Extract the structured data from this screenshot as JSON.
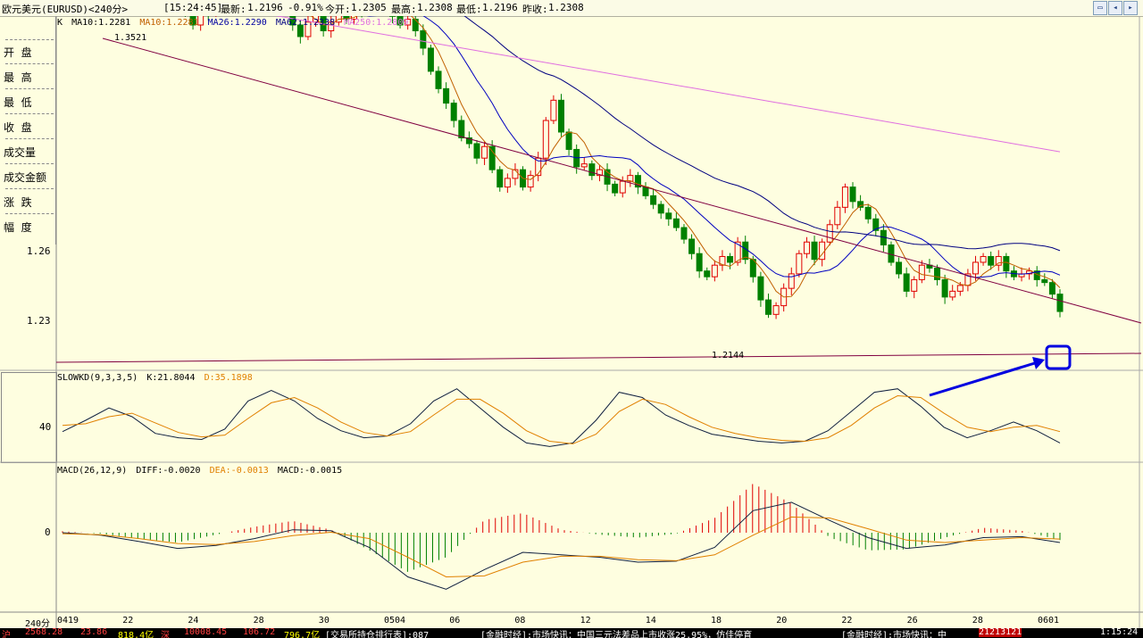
{
  "header": {
    "instrument": "欧元美元(EURUSD)<240分>",
    "time": "[15:24:45]",
    "quote_latest_label": "最新:",
    "quote_latest": "1.2196",
    "quote_change": "-0.91%",
    "quote_open_label": "今开:",
    "quote_open": "1.2305",
    "quote_high_label": "最高:",
    "quote_high": "1.2308",
    "quote_low_label": "最低:",
    "quote_low": "1.2196",
    "quote_prev_label": "昨收:",
    "quote_prev": "1.2308",
    "btn_icons": [
      "window-icon",
      "chevron-left-icon",
      "chevron-right-icon"
    ]
  },
  "left_panel": {
    "items": [
      "开  盘",
      "最  高",
      "最  低",
      "收  盘",
      "成交量",
      "成交金额",
      "涨  跌",
      "幅  度"
    ]
  },
  "price_legend": {
    "k": "K",
    "ma10a": "MA10:1.2281",
    "ma10b": "MA10:1.2281",
    "ma26": "MA26:1.2290",
    "ma62": "MA62:1.2338",
    "ma250": "MA250:1.2809"
  },
  "kd_legend": {
    "name": "SLOWKD(9,3,3,5)",
    "k": "K:21.8044",
    "d": "D:35.1898"
  },
  "macd_legend": {
    "name": "MACD(26,12,9)",
    "diff": "DIFF:-0.0020",
    "dea": "DEA:-0.0013",
    "macd": "MACD:-0.0015"
  },
  "axis": {
    "price_ticks": [
      "1.26",
      "1.23"
    ],
    "kd_tick": "40",
    "macd_tick": "0",
    "period": "240分"
  },
  "annotations": {
    "high_label": "1.3521",
    "low_label": "1.2144"
  },
  "bottom_bar": {
    "items": [
      "沪",
      "2568.28",
      "23.86",
      "818.4亿",
      "深",
      "10008.45",
      "106.72",
      "796.7亿",
      "[交易所持仓排行表]:087",
      "[金融时经]:市场快讯：中国三元法差品上市收涨25.95%，仿佳停育",
      "[金融时经]:市场快讯：中",
      "21213121",
      "1:15:24"
    ]
  },
  "colors": {
    "up": "#e00000",
    "down": "#008000",
    "ma10": "#c06000",
    "ma26": "#0000c0",
    "ma62": "#0000c0",
    "ma250": "#e070e0",
    "trendline": "#800040",
    "kd_k": "#102040",
    "kd_d": "#e08000",
    "arrow": "#0000e0"
  },
  "chart_data": [
    {
      "type": "candlestick",
      "title": "欧元美元(EURUSD)<240分>",
      "x_labels": [
        "0419",
        "22",
        "24",
        "28",
        "30",
        "0504",
        "06",
        "08",
        "12",
        "14",
        "18",
        "20",
        "22",
        "26",
        "28",
        "0601"
      ],
      "ylim": [
        1.207,
        1.318
      ],
      "y_ticks": [
        1.26,
        1.23
      ],
      "high_point": 1.3521,
      "low_point": 1.2144,
      "closes": [
        1.347,
        1.345,
        1.343,
        1.347,
        1.35,
        1.349,
        1.346,
        1.341,
        1.339,
        1.342,
        1.336,
        1.338,
        1.334,
        1.337,
        1.335,
        1.328,
        1.322,
        1.318,
        1.324,
        1.322,
        1.33,
        1.327,
        1.332,
        1.336,
        1.331,
        1.333,
        1.328,
        1.334,
        1.332,
        1.326,
        1.318,
        1.314,
        1.319,
        1.323,
        1.316,
        1.319,
        1.323,
        1.32,
        1.325,
        1.323,
        1.327,
        1.328,
        1.324,
        1.321,
        1.318,
        1.32,
        1.316,
        1.31,
        1.302,
        1.296,
        1.291,
        1.285,
        1.279,
        1.277,
        1.272,
        1.276,
        1.268,
        1.262,
        1.265,
        1.268,
        1.262,
        1.266,
        1.272,
        1.285,
        1.292,
        1.281,
        1.275,
        1.269,
        1.27,
        1.266,
        1.268,
        1.263,
        1.26,
        1.264,
        1.266,
        1.262,
        1.259,
        1.256,
        1.253,
        1.251,
        1.248,
        1.244,
        1.239,
        1.233,
        1.231,
        1.235,
        1.238,
        1.236,
        1.243,
        1.237,
        1.231,
        1.223,
        1.218,
        1.221,
        1.227,
        1.232,
        1.239,
        1.243,
        1.237,
        1.243,
        1.249,
        1.255,
        1.262,
        1.257,
        1.255,
        1.251,
        1.247,
        1.242,
        1.236,
        1.232,
        1.226,
        1.23,
        1.235,
        1.234,
        1.23,
        1.224,
        1.226,
        1.228,
        1.232,
        1.236,
        1.238,
        1.235,
        1.238,
        1.233,
        1.231,
        1.232,
        1.233,
        1.23,
        1.229,
        1.225,
        1.219
      ]
    },
    {
      "type": "line",
      "title": "SLOWKD(9,3,3,5)",
      "series": [
        {
          "name": "K",
          "values": [
            35,
            48,
            62,
            52,
            33,
            28,
            26,
            38,
            70,
            82,
            70,
            50,
            36,
            28,
            30,
            44,
            70,
            84,
            62,
            40,
            22,
            18,
            22,
            48,
            80,
            74,
            54,
            42,
            32,
            28,
            24,
            22,
            24,
            36,
            58,
            80,
            84,
            64,
            40,
            28,
            36,
            46,
            36,
            22
          ]
        },
        {
          "name": "D",
          "values": [
            42,
            44,
            52,
            56,
            45,
            34,
            29,
            31,
            50,
            68,
            74,
            62,
            46,
            34,
            30,
            35,
            54,
            72,
            72,
            56,
            36,
            24,
            21,
            32,
            58,
            72,
            66,
            52,
            40,
            33,
            28,
            25,
            24,
            28,
            42,
            62,
            76,
            74,
            56,
            40,
            35,
            40,
            42,
            35
          ]
        }
      ],
      "y_ticks": [
        40
      ]
    },
    {
      "type": "bar",
      "title": "MACD(26,12,9)",
      "series": [
        {
          "name": "DIFF",
          "values": [
            0.0,
            -0.0005,
            -0.0018,
            -0.0032,
            -0.0026,
            -0.0012,
            0.0006,
            0.0004,
            -0.003,
            -0.009,
            -0.0115,
            -0.0075,
            -0.004,
            -0.0045,
            -0.005,
            -0.006,
            -0.0058,
            -0.003,
            0.0045,
            0.0062,
            0.0025,
            -0.001,
            -0.0032,
            -0.0025,
            -0.001,
            -0.0008,
            -0.002
          ]
        },
        {
          "name": "DEA",
          "values": [
            -0.0002,
            -0.0004,
            -0.0012,
            -0.0022,
            -0.0024,
            -0.0018,
            -0.0006,
            0.0001,
            -0.0012,
            -0.005,
            -0.009,
            -0.0088,
            -0.006,
            -0.0048,
            -0.0048,
            -0.0055,
            -0.0057,
            -0.0045,
            -0.0005,
            0.0032,
            0.003,
            0.0008,
            -0.0015,
            -0.002,
            -0.0015,
            -0.001,
            -0.0013
          ]
        },
        {
          "name": "MACD",
          "values": [
            0.0003,
            -0.0002,
            -0.0012,
            -0.002,
            -0.0004,
            0.0012,
            0.0024,
            0.0006,
            -0.0036,
            -0.008,
            -0.005,
            0.0026,
            0.004,
            0.0006,
            -0.0004,
            -0.001,
            -0.0002,
            0.003,
            0.01,
            0.006,
            -0.001,
            -0.0036,
            -0.0034,
            -0.001,
            0.001,
            0.0004,
            -0.0015
          ]
        }
      ],
      "y_ticks": [
        0
      ]
    }
  ]
}
